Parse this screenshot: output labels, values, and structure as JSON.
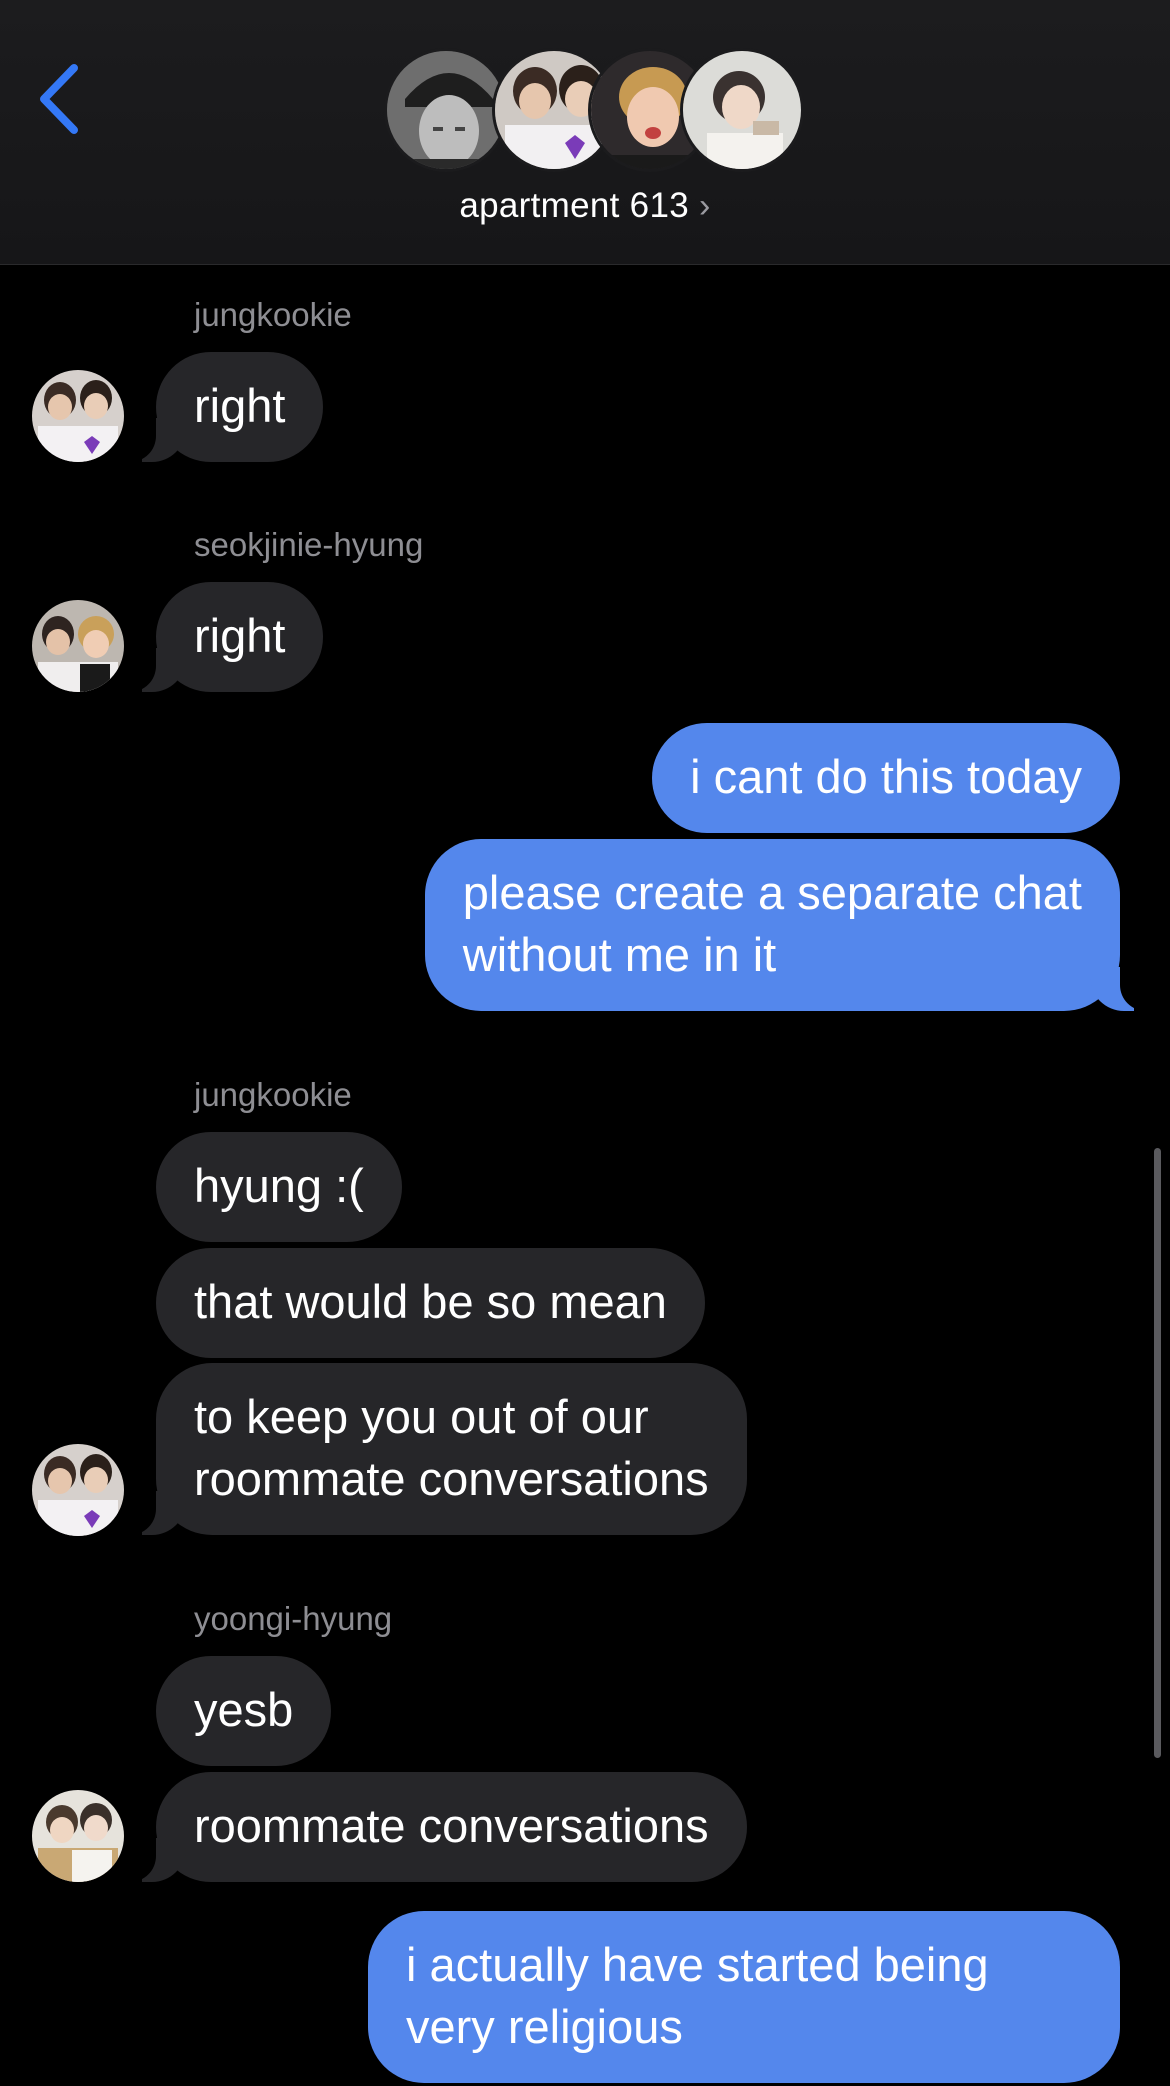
{
  "header": {
    "title": "apartment 613",
    "chevron": "›",
    "back_icon": "chevron-left-icon",
    "accent_color": "#3478f6"
  },
  "messages": {
    "g1_sender": "jungkookie",
    "g1_m1": "right",
    "g2_sender": "seokjinie-hyung",
    "g2_m1": "right",
    "out1_m1": "i cant do this today",
    "out1_m2_l1": "please create a separate chat",
    "out1_m2_l2": "without me in it",
    "g3_sender": "jungkookie",
    "g3_m1": "hyung :(",
    "g3_m2": "that would be so mean",
    "g3_m3_l1": "to keep you out of our",
    "g3_m3_l2": "roommate conversations",
    "g4_sender": "yoongi-hyung",
    "g4_m1": "yesb",
    "g4_m2": "roommate conversations",
    "out2_m1_l1": "i actually have started being",
    "out2_m1_l2": "very religious"
  },
  "colors": {
    "incoming_bubble": "#262629",
    "outgoing_bubble": "#5487ec",
    "sender_name": "#8e8e93"
  }
}
